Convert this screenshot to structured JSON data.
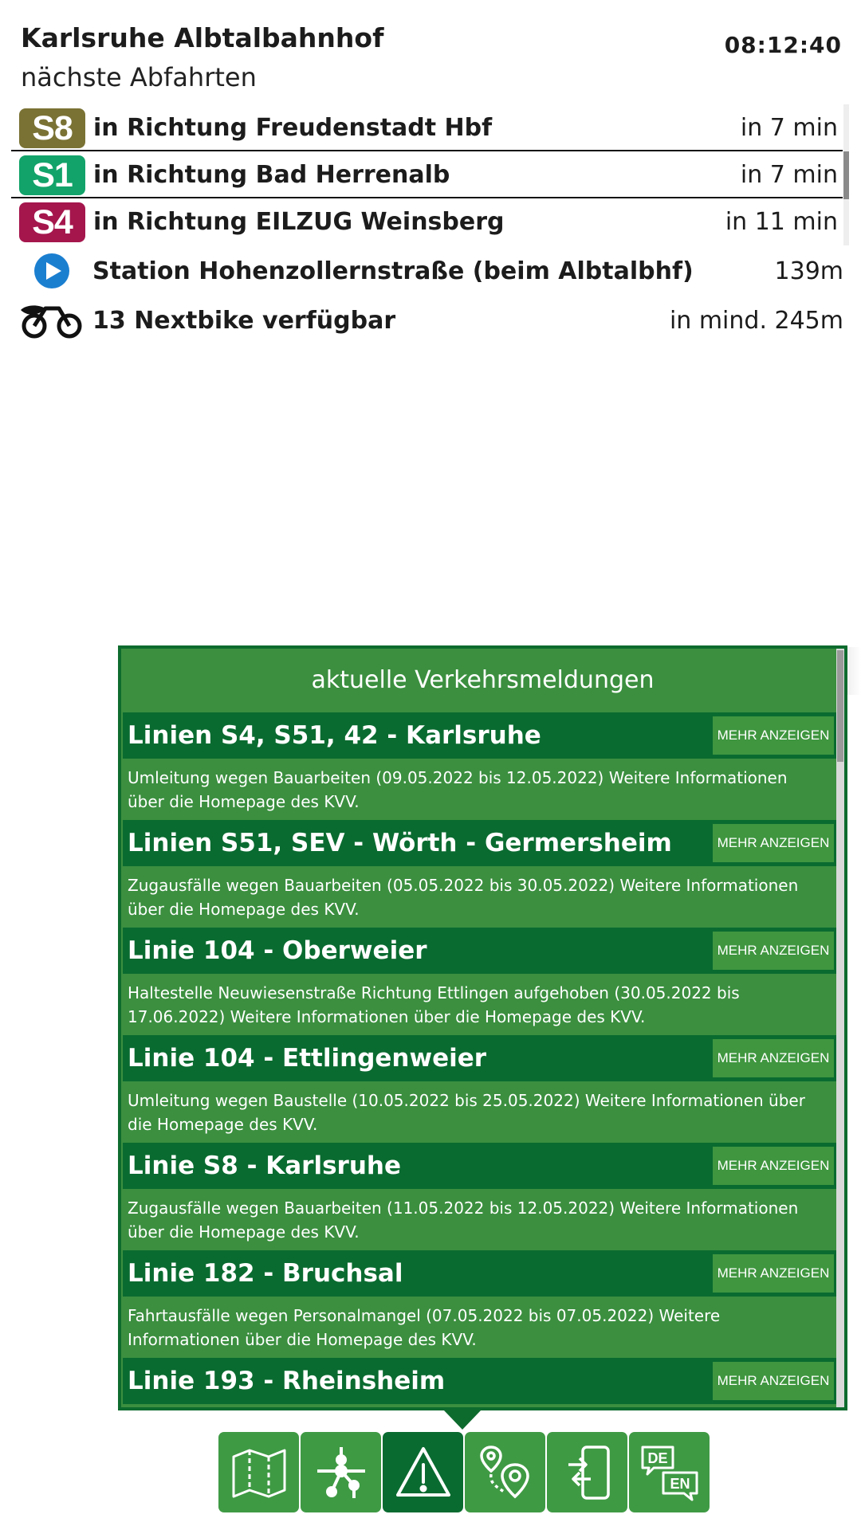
{
  "header": {
    "station": "Karlsruhe Albtalbahnhof",
    "subtitle": "nächste Abfahrten",
    "time": "08:12:40"
  },
  "departures": [
    {
      "line": "S8",
      "color": "#7a7234",
      "destination": "in Richtung Freudenstadt Hbf",
      "time": "in 7 min"
    },
    {
      "line": "S1",
      "color": "#12a36a",
      "destination": "in Richtung Bad Herrenalb",
      "time": "in 7 min"
    },
    {
      "line": "S4",
      "color": "#a5164d",
      "destination": "in Richtung EILZUG Weinsberg",
      "time": "in 11 min"
    }
  ],
  "nearby": {
    "station": {
      "icon": "play-circle-icon",
      "text": "Station Hohenzollernstraße (beim Albtalbhf)",
      "distance": "139m"
    },
    "bike": {
      "icon": "nextbike-icon",
      "text": "13 Nextbike verfügbar",
      "distance": "in mind. 245m"
    }
  },
  "news": {
    "title": "aktuelle Verkehrsmeldungen",
    "more_label": "MEHR ANZEIGEN",
    "items": [
      {
        "title": "Linien S4, S51, 42 - Karlsruhe",
        "text": "Umleitung wegen Bauarbeiten (09.05.2022 bis 12.05.2022) Weitere Informationen über die Homepage des KVV."
      },
      {
        "title": "Linien S51, SEV - Wörth - Germersheim",
        "text": "Zugausfälle wegen Bauarbeiten (05.05.2022 bis 30.05.2022) Weitere Informationen über die Homepage des KVV."
      },
      {
        "title": "Linie 104 - Oberweier",
        "text": "Haltestelle Neuwiesenstraße Richtung Ettlingen aufgehoben (30.05.2022 bis 17.06.2022) Weitere Informationen über die Homepage des KVV."
      },
      {
        "title": "Linie 104 - Ettlingenweier",
        "text": "Umleitung wegen Baustelle (10.05.2022 bis 25.05.2022) Weitere Informationen über die Homepage des KVV."
      },
      {
        "title": "Linie S8 - Karlsruhe",
        "text": "Zugausfälle wegen Bauarbeiten (11.05.2022 bis 12.05.2022) Weitere Informationen über die Homepage des KVV."
      },
      {
        "title": "Linie 182 - Bruchsal",
        "text": "Fahrtausfälle wegen Personalmangel (07.05.2022 bis 07.05.2022) Weitere Informationen über die Homepage des KVV."
      },
      {
        "title": "Linie 193 - Rheinsheim",
        "text": ""
      }
    ]
  },
  "nav": {
    "items": [
      {
        "icon": "map-icon",
        "active": false
      },
      {
        "icon": "network-icon",
        "active": false
      },
      {
        "icon": "warning-icon",
        "active": true
      },
      {
        "icon": "route-pin-icon",
        "active": false
      },
      {
        "icon": "phone-transfer-icon",
        "active": false
      },
      {
        "icon": "language-icon",
        "active": false,
        "labels": [
          "DE",
          "EN"
        ]
      }
    ]
  },
  "colors": {
    "panel": "#3b8f3f",
    "panel_dark": "#0a6b30",
    "nav_button": "#3f9a44"
  }
}
